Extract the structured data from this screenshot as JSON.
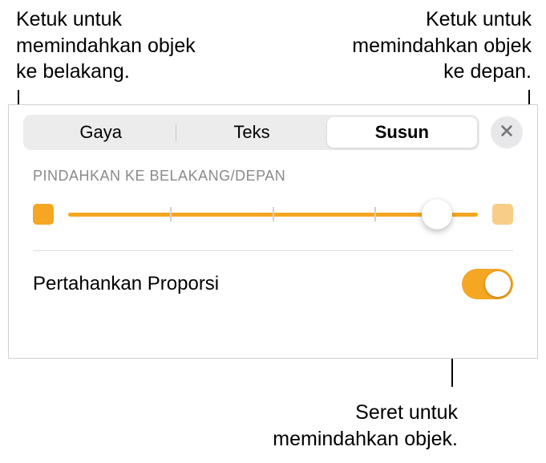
{
  "callouts": {
    "back_tap": "Ketuk untuk\nmemindahkan objek\nke belakang.",
    "front_tap": "Ketuk untuk\nmemindahkan objek\nke depan.",
    "drag": "Seret untuk\nmemindahkan objek."
  },
  "tabs": {
    "style": "Gaya",
    "text": "Teks",
    "arrange": "Susun"
  },
  "section": {
    "move_label": "PINDAHKAN KE BELAKANG/DEPAN"
  },
  "slider": {
    "value_pct": 90
  },
  "proportion": {
    "label": "Pertahankan Proporsi",
    "on": true
  },
  "colors": {
    "accent": "#f5a623",
    "accent_light": "#f8cd88"
  }
}
